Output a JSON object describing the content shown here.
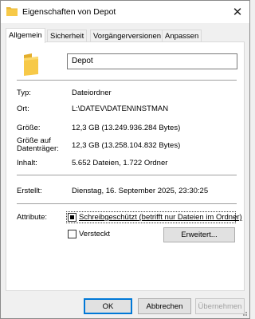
{
  "window": {
    "title": "Eigenschaften von Depot",
    "close_glyph": "✕"
  },
  "tabs": [
    {
      "label": "Allgemein",
      "active": true
    },
    {
      "label": "Sicherheit",
      "active": false
    },
    {
      "label": "Vorgängerversionen",
      "active": false
    },
    {
      "label": "Anpassen",
      "active": false
    }
  ],
  "general": {
    "name": "Depot",
    "type_label": "Typ:",
    "type_value": "Dateiordner",
    "location_label": "Ort:",
    "location_value": "L:\\DATEV\\DATEN\\INSTMAN",
    "size_label": "Größe:",
    "size_value": "12,3 GB (13.249.936.284 Bytes)",
    "disk_size_label_1": "Größe auf",
    "disk_size_label_2": "Datenträger:",
    "disk_size_value": "12,3 GB (13.258.104.832 Bytes)",
    "contents_label": "Inhalt:",
    "contents_value": "5.652 Dateien, 1.722 Ordner",
    "created_label": "Erstellt:",
    "created_value": "Dienstag, 16. September 2025, 23:30:25",
    "attributes_label": "Attribute:",
    "readonly_label": "Schreibgeschützt (betrifft nur Dateien im Ordner)",
    "readonly_state": "indeterminate",
    "hidden_label": "Versteckt",
    "hidden_state": "unchecked",
    "advanced_button": "Erweitert..."
  },
  "footer": {
    "ok": "OK",
    "cancel": "Abbrechen",
    "apply": "Übernehmen"
  },
  "colors": {
    "folder": "#f7c948",
    "accent": "#0078d7"
  },
  "icons": {
    "title": "folder-icon",
    "big": "folder-icon"
  }
}
